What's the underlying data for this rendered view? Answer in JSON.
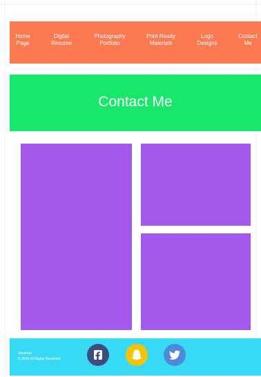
{
  "nav": {
    "items": [
      {
        "line1": "Home",
        "line2": "Page"
      },
      {
        "line1": "Digital",
        "line2": "Resume"
      },
      {
        "line1": "Photography",
        "line2": "Portfolio"
      },
      {
        "line1": "Print Ready",
        "line2": "Materials"
      },
      {
        "line1": "Logo",
        "line2": "Designs"
      },
      {
        "line1": "Contact",
        "line2": "Me"
      }
    ]
  },
  "contact": {
    "title": "Contact Me"
  },
  "footer": {
    "line1": "Seniorita",
    "line2": "© 2014 All Rights Reserved"
  },
  "social": [
    {
      "name": "facebook-icon",
      "color": "#3b4f7e"
    },
    {
      "name": "snapchat-icon",
      "color": "#f4c400"
    },
    {
      "name": "twitter-icon",
      "color": "#4f89d9"
    }
  ],
  "colors": {
    "nav": "#fd7951",
    "banner": "#17e86c",
    "tiles": "#a259ec",
    "footer": "#38d9f4"
  }
}
